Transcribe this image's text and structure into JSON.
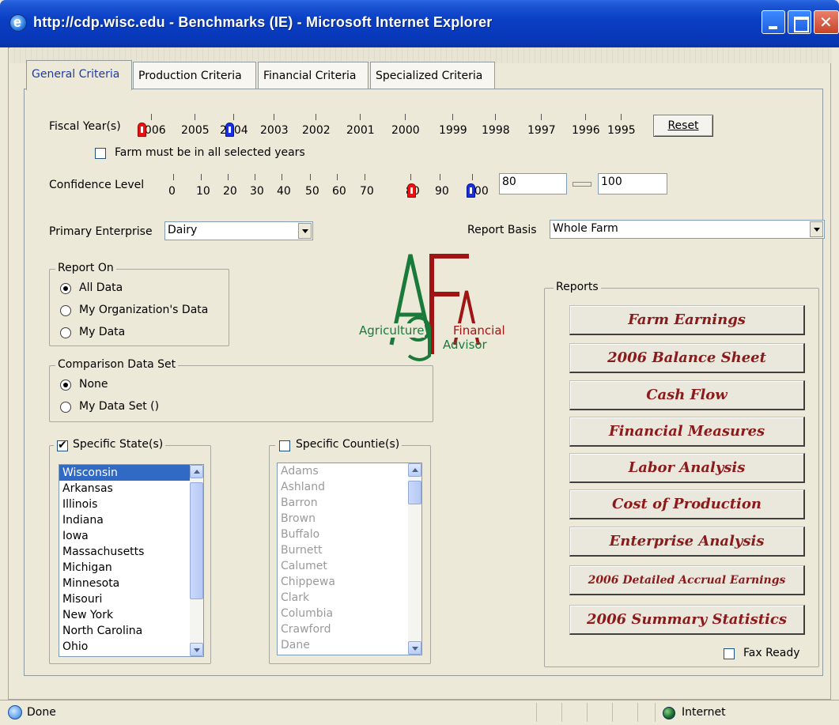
{
  "window": {
    "title": "http://cdp.wisc.edu - Benchmarks (IE) - Microsoft Internet Explorer"
  },
  "tabs": [
    {
      "label": "General Criteria",
      "active": true
    },
    {
      "label": "Production Criteria",
      "active": false
    },
    {
      "label": "Financial Criteria",
      "active": false
    },
    {
      "label": "Specialized Criteria",
      "active": false
    }
  ],
  "fiscal_year": {
    "label": "Fiscal Year(s)",
    "years": [
      "2006",
      "2005",
      "2004",
      "2003",
      "2002",
      "2001",
      "2000",
      "1999",
      "1998",
      "1997",
      "1996",
      "1995"
    ],
    "selected_from": "2006",
    "selected_to": "2004",
    "reset_label": "Reset",
    "all_years_label": "Farm must be in all selected years",
    "all_years_checked": false
  },
  "confidence": {
    "label": "Confidence Level",
    "ticks": [
      "0",
      "10",
      "20",
      "30",
      "40",
      "50",
      "60",
      "70",
      "80",
      "90",
      "100"
    ],
    "min_value": "80",
    "max_value": "100"
  },
  "primary_enterprise": {
    "label": "Primary Enterprise",
    "value": "Dairy"
  },
  "report_basis": {
    "label": "Report Basis",
    "value": "Whole Farm"
  },
  "report_on": {
    "legend": "Report On",
    "options": [
      {
        "label": "All Data",
        "checked": true
      },
      {
        "label": "My Organization's Data",
        "checked": false
      },
      {
        "label": "My Data",
        "checked": false
      }
    ]
  },
  "comparison": {
    "legend": "Comparison Data Set",
    "options": [
      {
        "label": "None",
        "checked": true
      },
      {
        "label": "My Data Set ()",
        "checked": false
      }
    ]
  },
  "logo": {
    "word1": "Agriculture",
    "word2": "Financial",
    "word3": "Advisor",
    "colors": {
      "green": "#1a7a3a",
      "red": "#a01414"
    }
  },
  "states": {
    "legend": "Specific State(s)",
    "checked": true,
    "items": [
      "Wisconsin",
      "Arkansas",
      "Illinois",
      "Indiana",
      "Iowa",
      "Massachusetts",
      "Michigan",
      "Minnesota",
      "Misouri",
      "New York",
      "North Carolina",
      "Ohio"
    ],
    "selected_index": 0
  },
  "counties": {
    "legend": "Specific Countie(s)",
    "checked": false,
    "items": [
      "Adams",
      "Ashland",
      "Barron",
      "Brown",
      "Buffalo",
      "Burnett",
      "Calumet",
      "Chippewa",
      "Clark",
      "Columbia",
      "Crawford",
      "Dane"
    ]
  },
  "reports": {
    "legend": "Reports",
    "buttons": [
      {
        "label": "Farm Earnings"
      },
      {
        "label": "2006 Balance Sheet"
      },
      {
        "label": "Cash Flow"
      },
      {
        "label": "Financial Measures"
      },
      {
        "label": "Labor Analysis"
      },
      {
        "label": "Cost of Production"
      },
      {
        "label": "Enterprise Analysis"
      },
      {
        "label": "2006 Detailed Accrual Earnings"
      },
      {
        "label": "2006 Summary Statistics"
      }
    ],
    "fax_ready_label": "Fax Ready",
    "fax_ready_checked": false,
    "button_text_color": "#8b1a1a"
  },
  "status": {
    "left": "Done",
    "zone": "Internet"
  }
}
